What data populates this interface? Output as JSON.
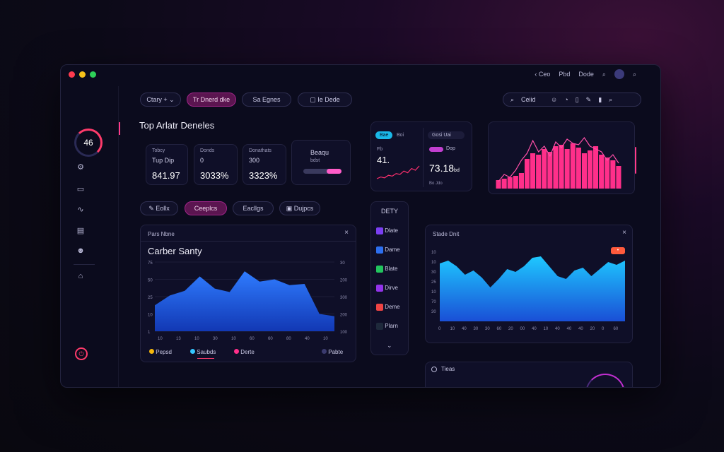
{
  "topnav": {
    "back_label": "Ceo",
    "item1": "Pbd",
    "item2": "Dode"
  },
  "sidebar": {
    "ring_value": "46"
  },
  "filters": [
    {
      "label": "Ctary +"
    },
    {
      "label": "Tr Dnerd dke"
    },
    {
      "label": "Sa Egnes"
    },
    {
      "label": "Ie Dede"
    }
  ],
  "search": {
    "label": "Ceiid"
  },
  "page_title": "Top Arlatr Deneles",
  "stats": [
    {
      "label": "Tobcy",
      "sub": "Tup Dip",
      "value": "841.97"
    },
    {
      "label": "Donds",
      "sub": "0",
      "value": "3033%"
    },
    {
      "label": "Donathats",
      "sub": "300",
      "value": "3323%"
    }
  ],
  "progress_card": {
    "title": "Beaqu",
    "sub": "bdst",
    "level": 0.55
  },
  "mini_card": {
    "tab1": "Bae",
    "tab2": "Boi",
    "value": "41.",
    "label": "Fb"
  },
  "mini_card2": {
    "tab": "Gosi Uai",
    "toggle_label": "Dop",
    "value": "73.18",
    "unit": "bd",
    "footer": "Bo Jdo"
  },
  "tabs": [
    {
      "label": "Eollx"
    },
    {
      "label": "Ceeplcs"
    },
    {
      "label": "Eacllgs"
    },
    {
      "label": "Dujpcs"
    }
  ],
  "left_chart_card": {
    "header": "Pars Nbne",
    "title": "Carber Santy"
  },
  "legend": [
    {
      "label": "Pepsd",
      "color": "#f5b70c"
    },
    {
      "label": "Saubds",
      "color": "#35c6ff"
    },
    {
      "label": "Derte",
      "color": "#ff2f8a"
    },
    {
      "label": "Pabte",
      "color": "#3a3a6e"
    }
  ],
  "mid_list": {
    "title": "DETY",
    "items": [
      {
        "label": "Dlate",
        "color": "#7b3ff2"
      },
      {
        "label": "Dame",
        "color": "#2d6ff0"
      },
      {
        "label": "Blate",
        "color": "#22c55e"
      },
      {
        "label": "Dirve",
        "color": "#9333ea"
      },
      {
        "label": "Deme",
        "color": "#ef4444"
      },
      {
        "label": "Plarn",
        "color": "#1e293b"
      }
    ]
  },
  "right_chart_card": {
    "header": "Stade Dnit",
    "badge": "•"
  },
  "bottom_card": {
    "label": "Tieas"
  },
  "chart_data": [
    {
      "type": "area",
      "title": "Carber Santy",
      "x": [
        0,
        1,
        2,
        3,
        4,
        5,
        6,
        7,
        8,
        9,
        10,
        11,
        12
      ],
      "values": [
        45,
        62,
        70,
        95,
        74,
        68,
        104,
        86,
        90,
        80,
        82,
        30,
        26
      ],
      "yticks_left": [
        "75",
        "50",
        "25",
        "10",
        "1"
      ],
      "yticks_right": [
        "30",
        "200",
        "300",
        "200",
        "100"
      ],
      "xticks": [
        "10",
        "13",
        "10",
        "30",
        "10",
        "60",
        "60",
        "80",
        "40",
        "10"
      ],
      "ylim": [
        0,
        120
      ]
    },
    {
      "type": "area",
      "title": "",
      "values": [
        82,
        86,
        78,
        66,
        72,
        62,
        48,
        60,
        74,
        70,
        78,
        90,
        92,
        78,
        64,
        60,
        72,
        76,
        64,
        74,
        84,
        80,
        86
      ],
      "yticks": [
        "10",
        "10",
        "30",
        "25",
        "10",
        "70",
        "30"
      ],
      "xticks": [
        "0",
        "10",
        "40",
        "30",
        "30",
        "60",
        "20",
        "00",
        "40",
        "10",
        "40",
        "40",
        "40",
        "20",
        "0",
        "60"
      ],
      "ylim": [
        0,
        100
      ]
    },
    {
      "type": "bar",
      "title": "",
      "values": [
        12,
        14,
        16,
        18,
        22,
        42,
        50,
        48,
        56,
        52,
        60,
        62,
        56,
        64,
        58,
        50,
        54,
        60,
        48,
        44,
        40,
        32
      ],
      "line": [
        10,
        20,
        16,
        26,
        40,
        50,
        68,
        52,
        60,
        46,
        66,
        58,
        70,
        64,
        62,
        72,
        60,
        56,
        52,
        40,
        48,
        36
      ],
      "ylim": [
        0,
        80
      ]
    },
    {
      "type": "line",
      "title": "",
      "values": [
        10,
        14,
        12,
        18,
        16,
        22,
        20,
        28,
        24,
        34,
        30,
        40
      ],
      "ylim": [
        0,
        50
      ]
    }
  ]
}
